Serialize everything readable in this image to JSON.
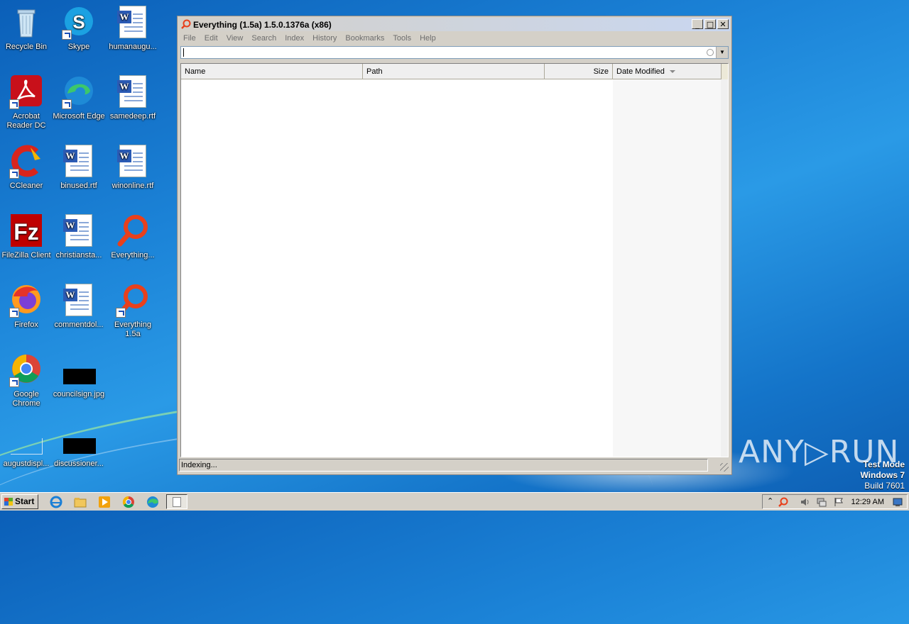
{
  "desktop": {
    "icons": [
      {
        "label": "Recycle Bin",
        "icon": "recycle-bin-icon"
      },
      {
        "label": "Skype",
        "icon": "skype-icon"
      },
      {
        "label": "humanaugu...",
        "icon": "word-document-icon"
      },
      {
        "label": "Acrobat Reader DC",
        "icon": "acrobat-icon"
      },
      {
        "label": "Microsoft Edge",
        "icon": "edge-icon"
      },
      {
        "label": "samedeep.rtf",
        "icon": "word-document-icon"
      },
      {
        "label": "CCleaner",
        "icon": "ccleaner-icon"
      },
      {
        "label": "binused.rtf",
        "icon": "word-document-icon"
      },
      {
        "label": "winonline.rtf",
        "icon": "word-document-icon"
      },
      {
        "label": "FileZilla Client",
        "icon": "filezilla-icon"
      },
      {
        "label": "christiansta...",
        "icon": "word-document-icon"
      },
      {
        "label": "Everything...",
        "icon": "everything-icon"
      },
      {
        "label": "Firefox",
        "icon": "firefox-icon"
      },
      {
        "label": "commentdol...",
        "icon": "word-document-icon"
      },
      {
        "label": "Everything 1.5a",
        "icon": "everything-icon"
      },
      {
        "label": "Google Chrome",
        "icon": "chrome-icon"
      },
      {
        "label": "councilsign.jpg",
        "icon": "image-file-icon"
      },
      {
        "label": "augustdispl...",
        "icon": "image-file-icon"
      },
      {
        "label": "discussioner...",
        "icon": "image-file-icon"
      }
    ]
  },
  "window": {
    "title": "Everything (1.5a) 1.5.0.1376a (x86)",
    "controls": {
      "minimize": "_",
      "maximize": "□",
      "close": "✕"
    },
    "menu": [
      "File",
      "Edit",
      "View",
      "Search",
      "Index",
      "History",
      "Bookmarks",
      "Tools",
      "Help"
    ],
    "search": {
      "value": "",
      "placeholder": ""
    },
    "columns": [
      "Name",
      "Path",
      "Size",
      "Date Modified"
    ],
    "status": "Indexing..."
  },
  "watermark": {
    "brand": "ANY▷RUN",
    "mode": "Test Mode",
    "os": "Windows 7",
    "build": "Build 7601"
  },
  "taskbar": {
    "start_label": "Start",
    "clock": "12:29 AM",
    "tray_expand": "⌃"
  },
  "colors": {
    "accent": "#1c84d8",
    "everything_red": "#e8401c"
  }
}
